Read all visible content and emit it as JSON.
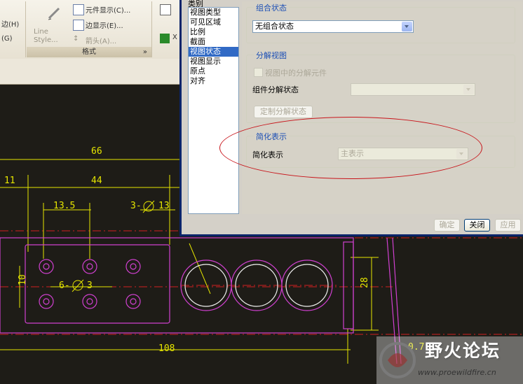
{
  "ribbon": {
    "left_items": [
      "边(H)",
      "(G)"
    ],
    "line_style_label": "Line Style...",
    "items": [
      "元件显示(C)...",
      "边显示(E)...",
      "箭头(A)..."
    ],
    "footer_label": "格式",
    "right_item": "X"
  },
  "dialog": {
    "category_label": "类别",
    "categories": [
      "视图类型",
      "可见区域",
      "比例",
      "截面",
      "视图状态",
      "视图显示",
      "原点",
      "对齐"
    ],
    "selected_category": "视图状态",
    "combined_state": {
      "title": "组合状态",
      "value": "无组合状态"
    },
    "exploded_view": {
      "title": "分解视图",
      "checkbox_label": "视图中的分解元件",
      "component_state_label": "组件分解状态",
      "component_state_value": "",
      "define_button": "定制分解状态"
    },
    "simplified_rep": {
      "title": "简化表示",
      "label": "简化表示",
      "value": "主表示"
    },
    "buttons": {
      "ok": "确定",
      "close": "关闭",
      "apply": "应用"
    }
  },
  "drawing": {
    "dims": [
      "66",
      "44",
      "11",
      "13.5",
      "3-",
      "13",
      "6-",
      "3",
      "10",
      "28",
      "108",
      "0.7"
    ]
  },
  "watermark": {
    "title": "野火论坛",
    "url": "www.proewildfire.cn"
  },
  "colors": {
    "drawing_bg": "#1e1c17",
    "dim_yellow": "#e6e600",
    "geometry_magenta": "#d040d0",
    "highlight_red": "#c8151b",
    "selection_blue": "#316ac5",
    "group_title_blue": "#1c4fb5"
  }
}
